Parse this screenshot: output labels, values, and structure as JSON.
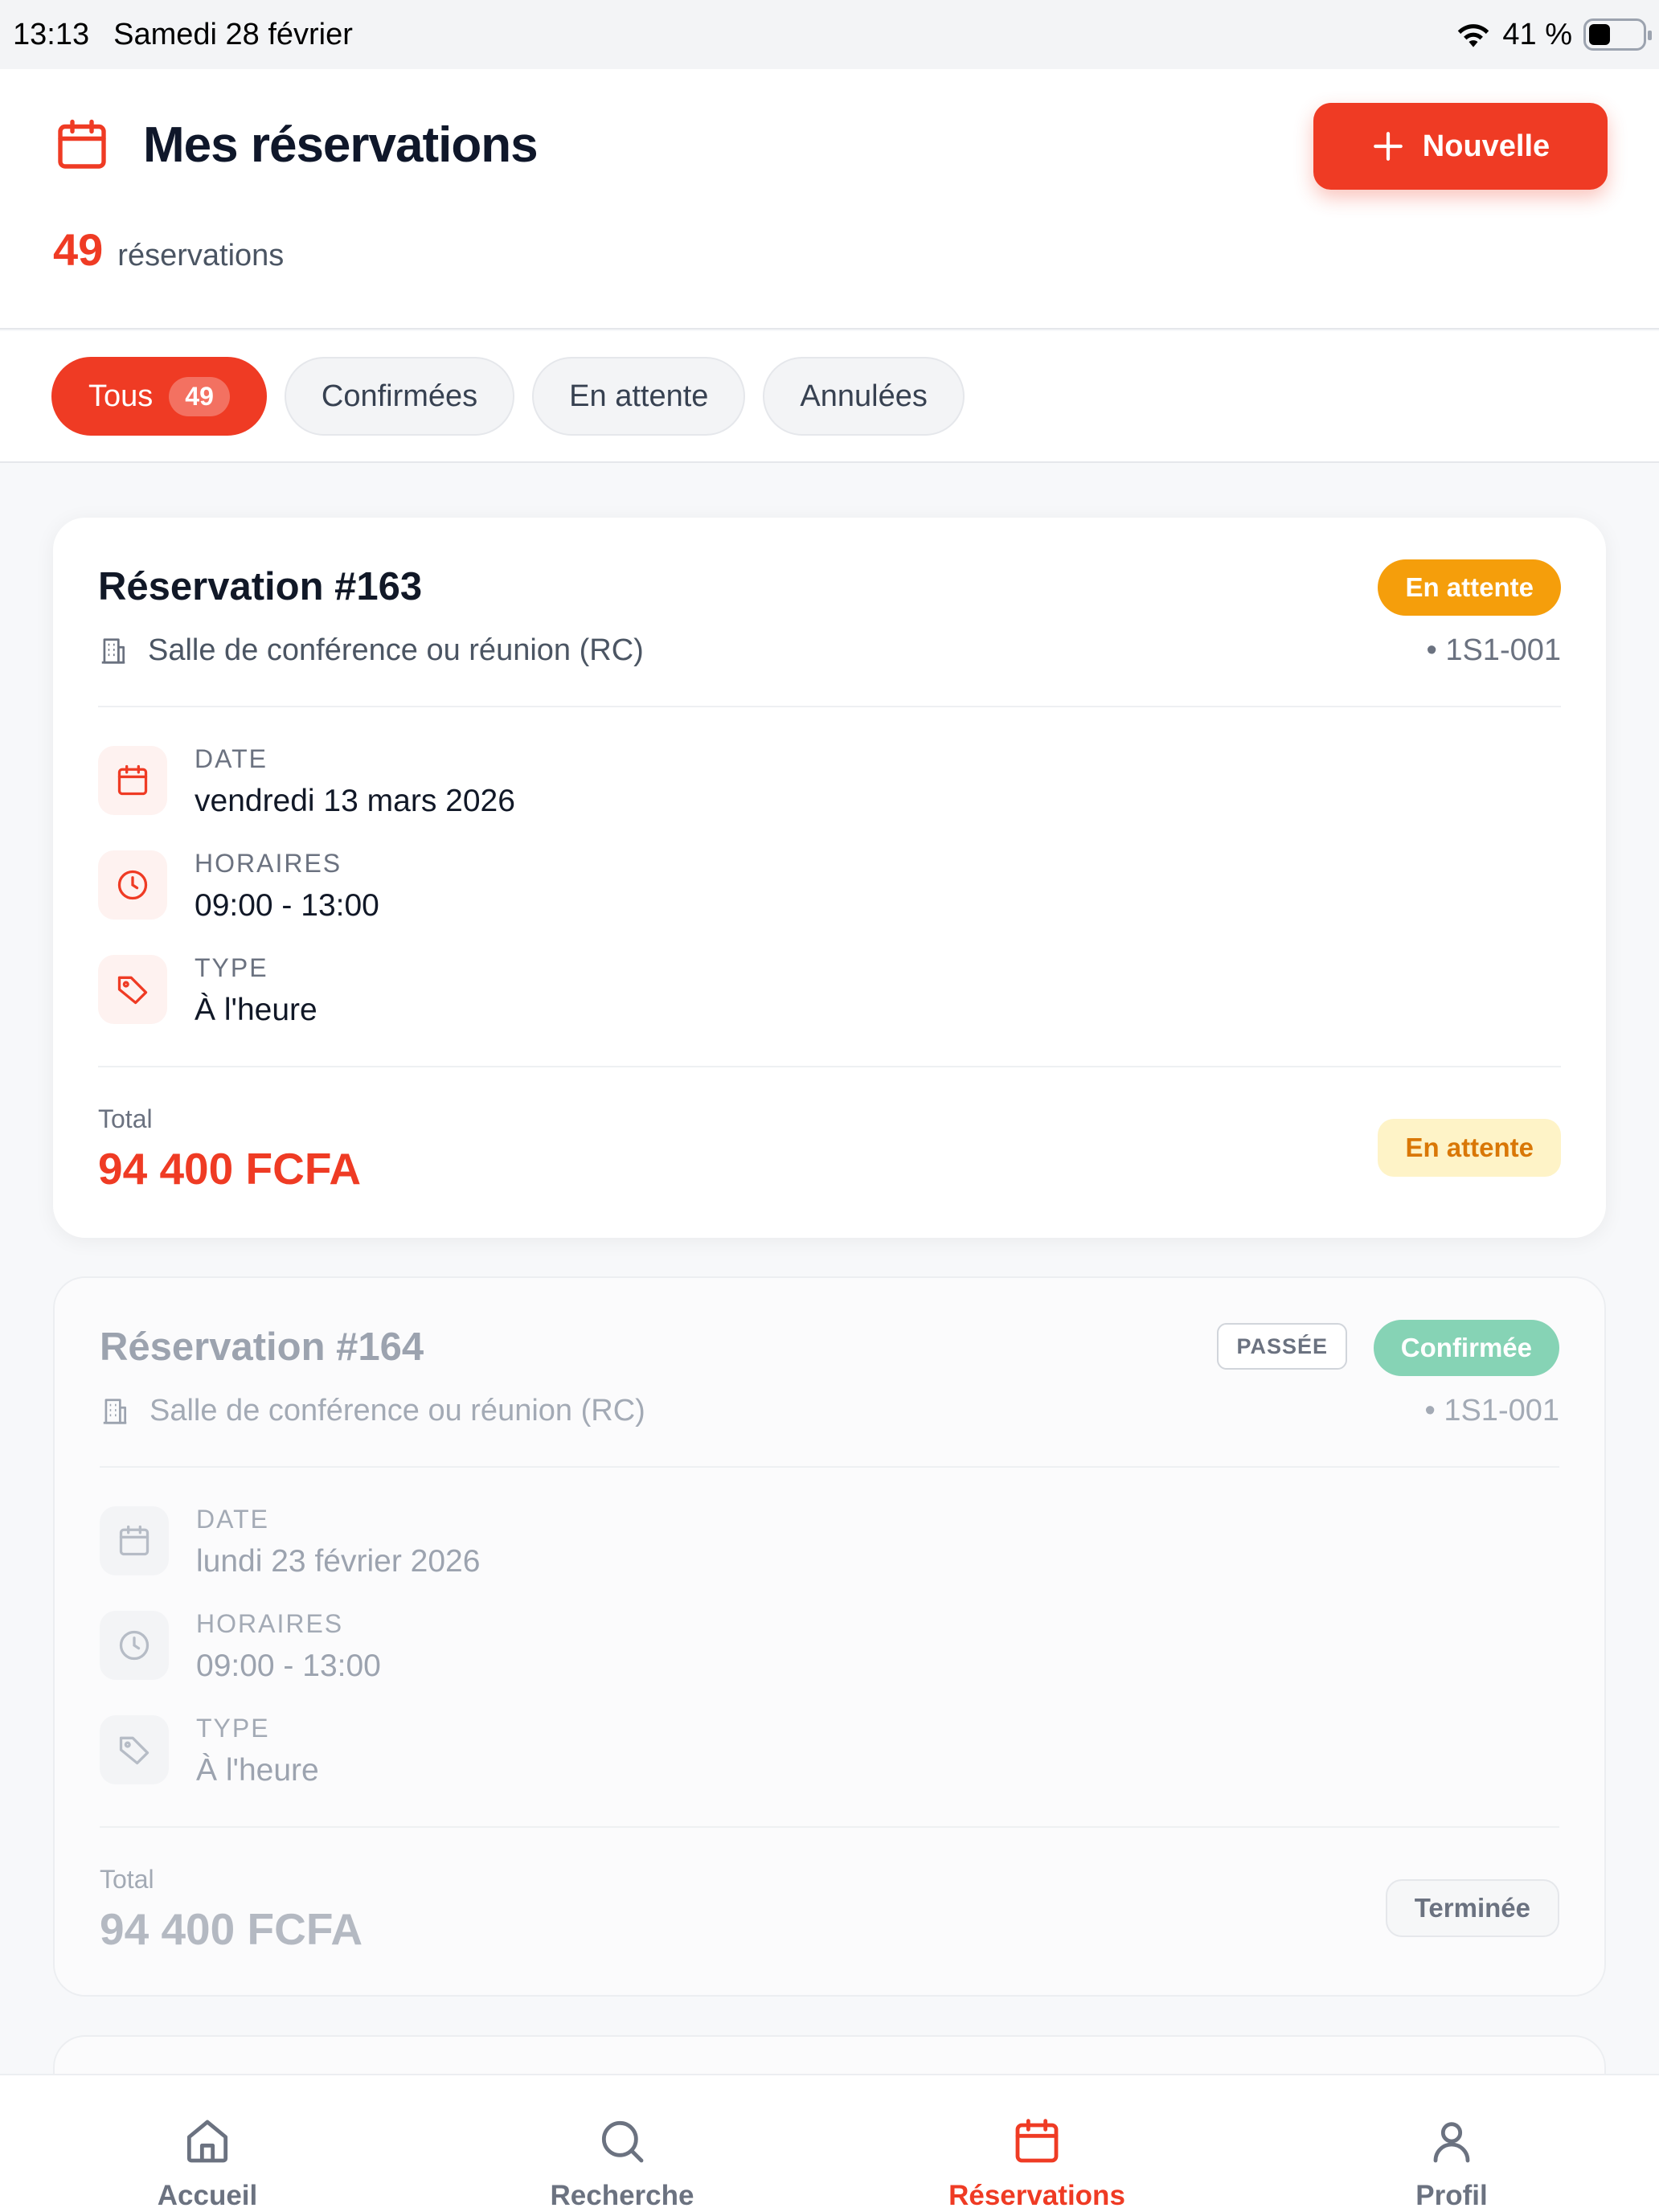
{
  "status_bar": {
    "time": "13:13",
    "date": "Samedi 28 février",
    "battery": "41 %"
  },
  "header": {
    "title": "Mes réservations",
    "count": "49",
    "count_label": "réservations",
    "new_button": "Nouvelle"
  },
  "tabs": [
    {
      "label": "Tous",
      "badge": "49",
      "active": true
    },
    {
      "label": "Confirmées"
    },
    {
      "label": "En attente"
    },
    {
      "label": "Annulées"
    }
  ],
  "reservations": [
    {
      "title": "Réservation #163",
      "status": "En attente",
      "room": "Salle de conférence ou réunion (RC)",
      "code": "• 1S1-001",
      "date_label": "DATE",
      "date": "vendredi 13 mars 2026",
      "hours_label": "HORAIRES",
      "hours": "09:00 - 13:00",
      "type_label": "TYPE",
      "type": "À l'heure",
      "total_label": "Total",
      "total": "94 400 FCFA",
      "footer_status": "En attente"
    },
    {
      "title": "Réservation #164",
      "past_tag": "PASSÉE",
      "status": "Confirmée",
      "room": "Salle de conférence ou réunion (RC)",
      "code": "• 1S1-001",
      "date_label": "DATE",
      "date": "lundi 23 février 2026",
      "hours_label": "HORAIRES",
      "hours": "09:00 - 13:00",
      "type_label": "TYPE",
      "type": "À l'heure",
      "total_label": "Total",
      "total": "94 400 FCFA",
      "footer_status": "Terminée"
    }
  ],
  "nav": [
    {
      "label": "Accueil",
      "icon": "home-icon"
    },
    {
      "label": "Recherche",
      "icon": "search-icon"
    },
    {
      "label": "Réservations",
      "icon": "calendar-icon",
      "active": true
    },
    {
      "label": "Profil",
      "icon": "user-icon"
    }
  ],
  "colors": {
    "accent": "#ef3b24",
    "pending": "#f59e0b",
    "confirmed": "#86d3b5"
  }
}
